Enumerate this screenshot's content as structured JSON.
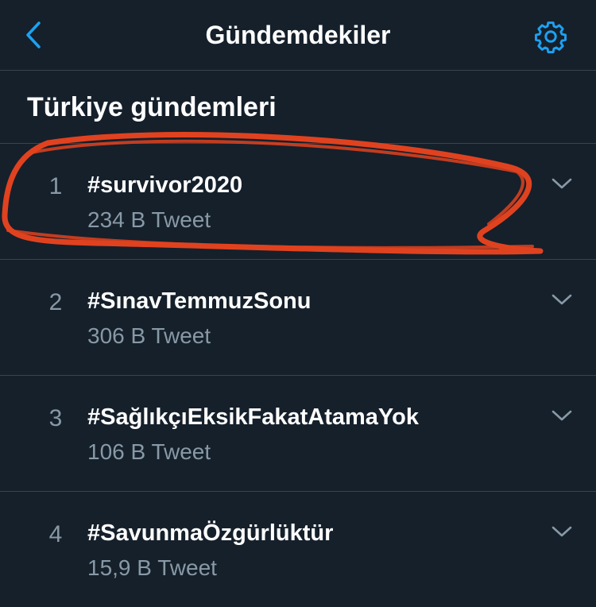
{
  "header": {
    "title": "Gündemdekiler",
    "back_icon": "chevron-left-icon",
    "settings_icon": "gear-icon"
  },
  "section": {
    "title": "Türkiye gündemleri"
  },
  "trends": [
    {
      "rank": "1",
      "tag": "#survivor2020",
      "count": "234 B Tweet"
    },
    {
      "rank": "2",
      "tag": "#SınavTemmuzSonu",
      "count": "306 B Tweet"
    },
    {
      "rank": "3",
      "tag": "#SağlıkçıEksikFakatAtamaYok",
      "count": "106 B Tweet"
    },
    {
      "rank": "4",
      "tag": "#SavunmaÖzgürlüktür",
      "count": "15,9 B Tweet"
    }
  ],
  "colors": {
    "background": "#15202b",
    "divider": "#38444d",
    "accent": "#1da1f2",
    "muted": "#8899a6",
    "highlight": "#e0421f"
  }
}
